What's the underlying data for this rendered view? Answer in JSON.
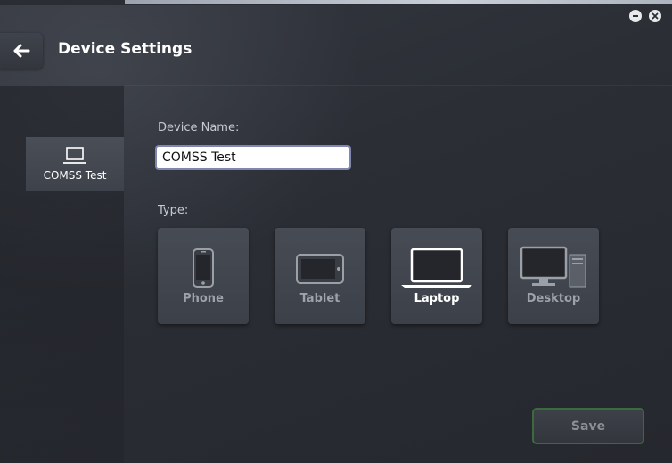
{
  "window": {
    "minimize_icon": "minus-icon",
    "close_icon": "close-icon"
  },
  "header": {
    "title": "Device Settings",
    "back_icon": "arrow-left-icon"
  },
  "sidebar": {
    "devices": [
      {
        "label": "COMSS Test",
        "icon": "laptop-icon",
        "selected": true
      }
    ]
  },
  "form": {
    "name_label": "Device Name:",
    "name_value": "COMSS Test",
    "type_label": "Type:",
    "types": [
      {
        "label": "Phone",
        "icon": "phone-icon",
        "selected": false
      },
      {
        "label": "Tablet",
        "icon": "tablet-icon",
        "selected": false
      },
      {
        "label": "Laptop",
        "icon": "laptop-icon",
        "selected": true
      },
      {
        "label": "Desktop",
        "icon": "desktop-icon",
        "selected": false
      }
    ]
  },
  "footer": {
    "save_label": "Save"
  },
  "colors": {
    "background": "#2c2f36",
    "save_border": "#3b6a3f",
    "input_border": "#7f86b0"
  }
}
